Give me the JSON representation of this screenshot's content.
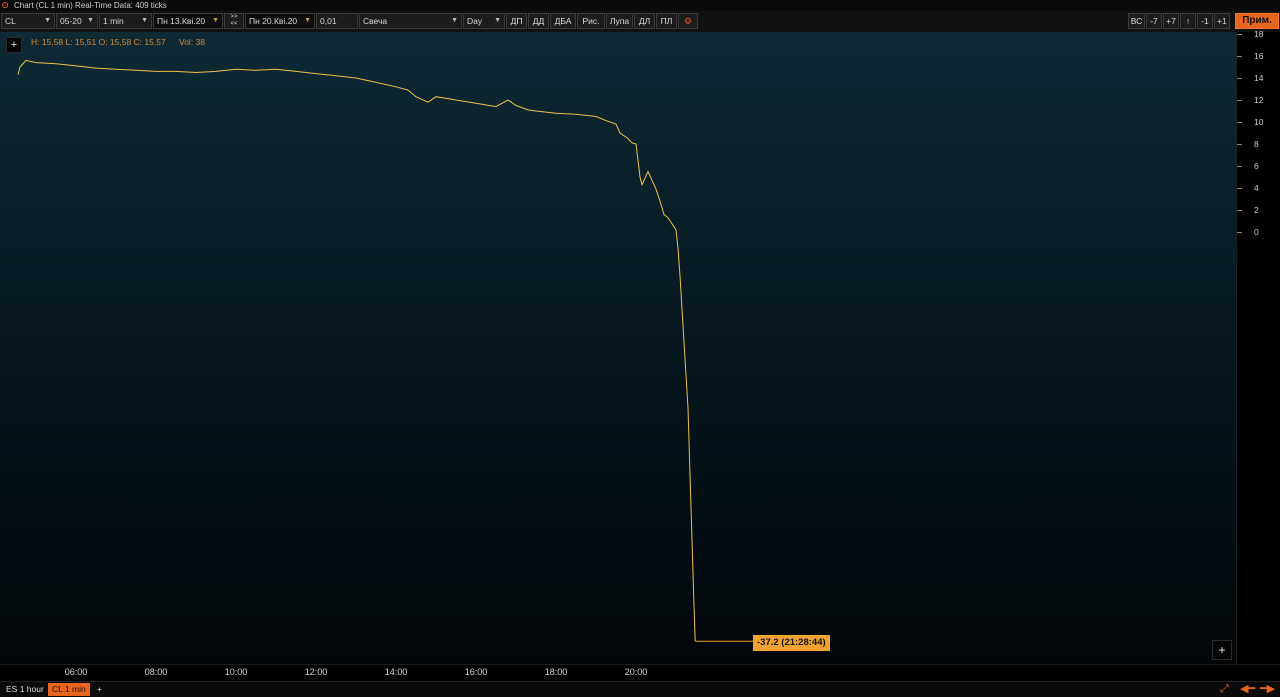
{
  "window": {
    "title": "Chart (CL 1 min) Real-Time Data: 409 ticks",
    "icon": "app-logo-icon"
  },
  "toolbar": {
    "symbol": "CL",
    "contract": "05-20",
    "interval": "1 min",
    "date_from": "Пн 13.Квi.20",
    "date_to": "Пн 20.Квi.20",
    "tick_size": "0,01",
    "chart_style": "Свеча",
    "session": "Day",
    "buttons": [
      "ДП",
      "ДД",
      "ДБА",
      "Рис.",
      "Лупа",
      "ДЛ",
      "ПЛ"
    ],
    "gear_icon": "settings-icon",
    "right_buttons": [
      "ВС",
      "-7",
      "+7",
      "↑",
      "-1",
      "+1"
    ],
    "apply_label": "Прим."
  },
  "chart": {
    "ohlc": "H: 15,58 L: 15,51 O: 15,58 C: 15,57",
    "volume": "Vol: 38",
    "last_price_label": "-37.2 (21:28:44)",
    "plus_label": "+",
    "colors": {
      "line": "#f0c04a",
      "tag": "#f2a22e",
      "accent": "#e8651e"
    }
  },
  "chart_data": {
    "type": "line",
    "x_unit": "hours",
    "ylim": [
      -40,
      18
    ],
    "xlim": [
      4.5,
      24
    ],
    "yticks": [
      18,
      16,
      14,
      12,
      10,
      8,
      6,
      4,
      2,
      0
    ],
    "xtick_labels": [
      "06:00",
      "08:00",
      "10:00",
      "12:00",
      "14:00",
      "16:00",
      "18:00",
      "20:00"
    ],
    "xtick_values": [
      6,
      8,
      10,
      12,
      14,
      16,
      18,
      20
    ],
    "x": [
      4.55,
      4.6,
      4.75,
      5.0,
      5.5,
      6.0,
      6.5,
      7.0,
      7.5,
      8.0,
      8.5,
      9.0,
      9.5,
      10.0,
      10.5,
      11.0,
      11.5,
      12.0,
      12.5,
      13.0,
      13.5,
      14.0,
      14.3,
      14.5,
      14.8,
      15.0,
      15.5,
      16.0,
      16.5,
      16.8,
      17.0,
      17.3,
      17.5,
      18.0,
      18.5,
      19.0,
      19.2,
      19.5,
      19.6,
      19.8,
      19.9,
      20.0,
      20.1,
      20.15,
      20.3,
      20.5,
      20.6,
      20.7,
      20.8,
      21.0,
      21.05,
      21.1,
      21.15,
      21.2,
      21.25,
      21.3,
      21.35,
      21.4,
      21.45,
      21.48
    ],
    "y": [
      14.3,
      15.0,
      15.6,
      15.4,
      15.3,
      15.1,
      14.9,
      14.8,
      14.7,
      14.6,
      14.6,
      14.5,
      14.6,
      14.8,
      14.7,
      14.8,
      14.6,
      14.4,
      14.2,
      14.0,
      13.6,
      13.2,
      12.9,
      12.3,
      11.8,
      12.3,
      12.0,
      11.7,
      11.4,
      12.0,
      11.5,
      11.1,
      11.0,
      10.8,
      10.7,
      10.5,
      10.2,
      9.8,
      9.0,
      8.5,
      8.1,
      8.0,
      5.0,
      4.3,
      5.5,
      3.9,
      2.8,
      1.6,
      1.3,
      0.2,
      -1.5,
      -4.0,
      -7.0,
      -10.0,
      -13.0,
      -16.0,
      -22.0,
      -28.0,
      -34.0,
      -37.2
    ]
  },
  "tabs": [
    {
      "label": "ES 1 hour"
    },
    {
      "label": "CL 1 min",
      "active": true
    },
    {
      "label": "+"
    }
  ],
  "nav_icons": [
    "expand-icon",
    "arrow-left-icon",
    "arrow-right-icon"
  ]
}
